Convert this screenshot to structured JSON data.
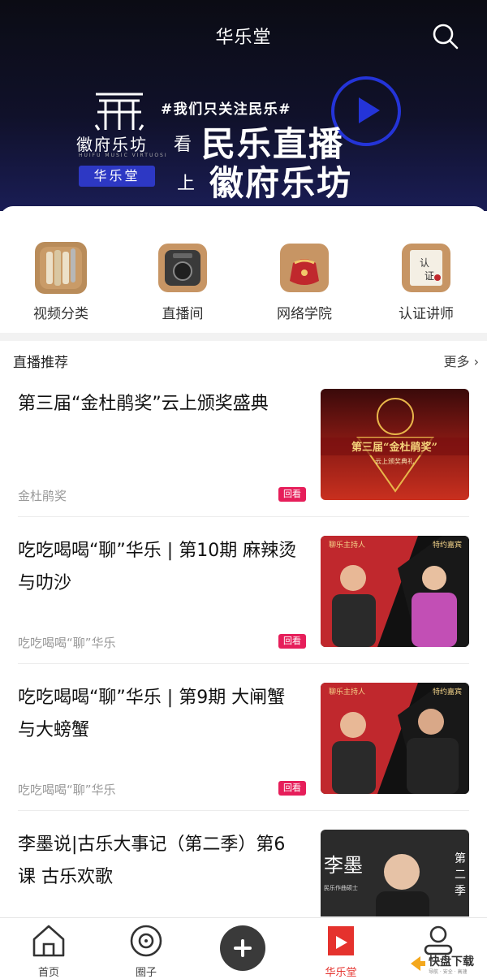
{
  "header": {
    "title": "华乐堂"
  },
  "banner": {
    "logo_text": "徽府乐坊",
    "logo_en": "HUIFU MUSIC VIRTUOSI",
    "badge": "华乐堂",
    "slogan": "#我们只关注民乐#",
    "kan": "看",
    "shang": "上",
    "line1": "民乐直播",
    "line2": "徽府乐坊"
  },
  "categories": [
    {
      "label": "视频分类",
      "icon": "scroll-icon"
    },
    {
      "label": "直播间",
      "icon": "radio-icon"
    },
    {
      "label": "网络学院",
      "icon": "pouch-icon"
    },
    {
      "label": "认证讲师",
      "icon": "certificate-icon"
    }
  ],
  "section": {
    "title": "直播推荐",
    "more": "更多"
  },
  "items": [
    {
      "title": "第三届“金杜鹃奖”云上颁奖盛典",
      "source": "金杜鹃奖",
      "tag": "回看",
      "thumb_text": "第三届“金杜鹃奖”",
      "thumb_sub": "云上颁奖典礼"
    },
    {
      "title": "吃吃喝喝“聊”华乐 | 第10期 麻辣烫与叻沙",
      "source": "吃吃喝喝“聊”华乐",
      "tag": "回看",
      "thumb_left": "聊乐主持人",
      "thumb_right": "特约嘉宾"
    },
    {
      "title": "吃吃喝喝“聊”华乐 | 第9期 大闸蟹与大螃蟹",
      "source": "吃吃喝喝“聊”华乐",
      "tag": "回看",
      "thumb_left": "聊乐主持人",
      "thumb_right": "特约嘉宾"
    },
    {
      "title": "李墨说|古乐大事记（第二季）第6课 古乐欢歌",
      "source": "",
      "tag": "",
      "thumb_text": "李墨",
      "thumb_sub": "民乐作曲硕士",
      "thumb_side": "第二季"
    }
  ],
  "nav": [
    {
      "label": "首页",
      "icon": "home-icon"
    },
    {
      "label": "圈子",
      "icon": "disc-icon"
    },
    {
      "label": "",
      "icon": "plus-icon"
    },
    {
      "label": "华乐堂",
      "icon": "hualetang-icon"
    },
    {
      "label": "",
      "icon": "user-icon"
    }
  ],
  "watermark": {
    "text": "快盘下载",
    "sub": "导航 · 安全 · 高速"
  },
  "colors": {
    "accent": "#e5322d",
    "tag": "#e61e5a",
    "banner_blue": "#2d38c4"
  }
}
